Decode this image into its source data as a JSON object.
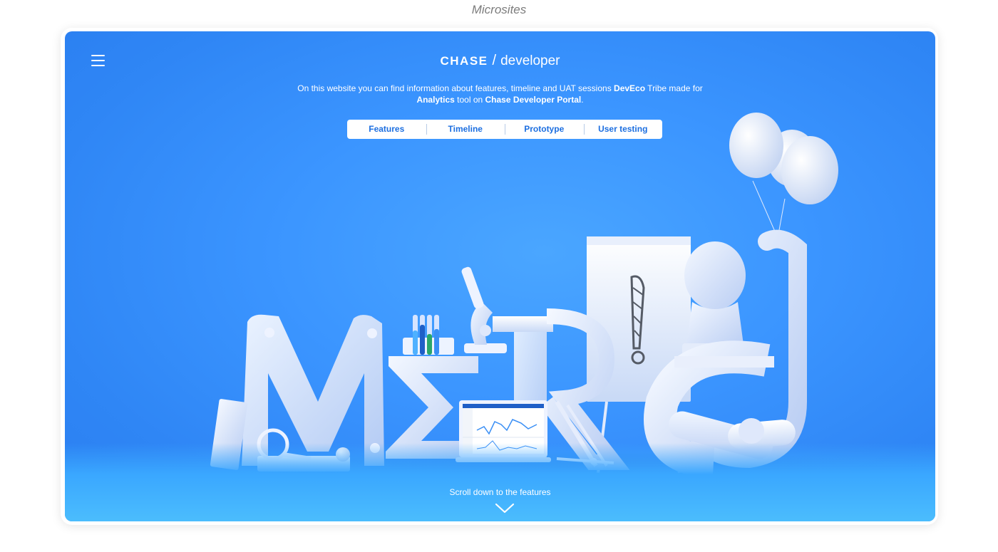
{
  "caption": "Microsites",
  "header": {
    "brand_name": "CHASE",
    "brand_separator": "/",
    "brand_product": "developer",
    "menu_icon": "hamburger-menu-icon"
  },
  "intro": {
    "part1": "On this website you can find information about features, timeline and UAT sessions ",
    "bold1": "DevEco",
    "part2": " Tribe made for ",
    "bold2": "Analytics",
    "part3": " tool on ",
    "bold3": "Chase Developer Portal",
    "part4": "."
  },
  "nav": {
    "tabs": [
      {
        "label": "Features"
      },
      {
        "label": "Timeline"
      },
      {
        "label": "Prototype"
      },
      {
        "label": "User testing"
      }
    ]
  },
  "footer": {
    "scroll_label": "Scroll down to the features",
    "scroll_icon": "chevron-down-icon"
  },
  "colors": {
    "background": "#3b95ff",
    "nav_text": "#1d6fe0",
    "text": "#ffffff"
  }
}
